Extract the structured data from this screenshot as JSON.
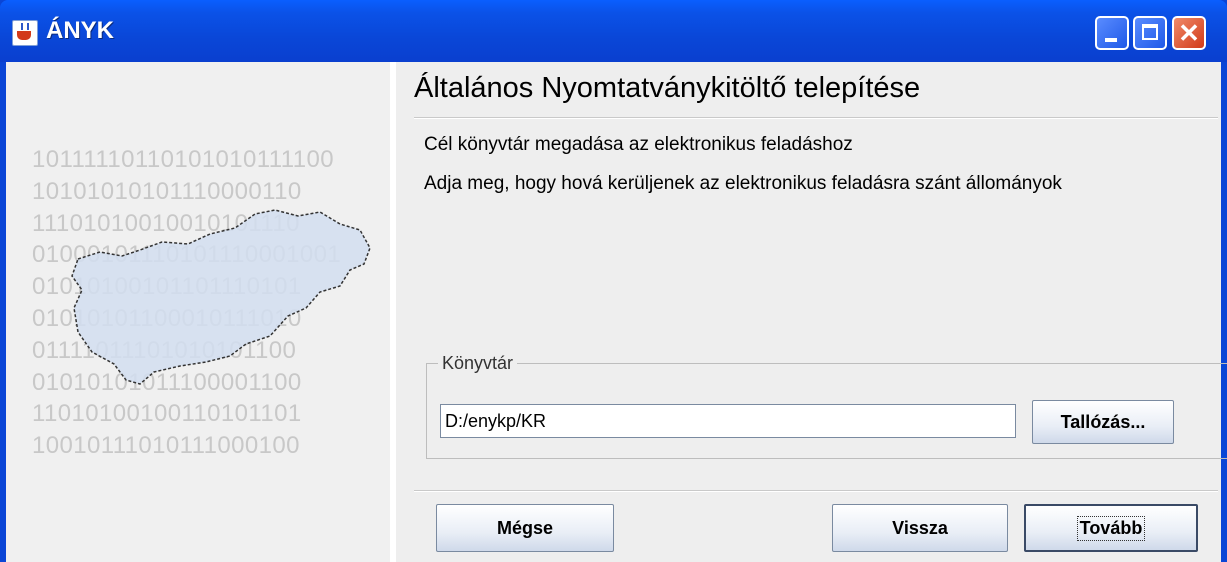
{
  "window": {
    "title": "ÁNYK"
  },
  "left_panel": {
    "binary_rows": [
      "10111110110101010111100",
      "10101010101110000110",
      "11101010010010101110",
      "01000101110101110001001",
      "01010100101101110101",
      "01010101100010111010",
      "01111011101010101100",
      "01010101011100001100",
      "11010100100110101101",
      "10010111010111000100"
    ]
  },
  "main": {
    "heading": "Általános Nyomtatványkitöltő telepítése",
    "subtitle": "Cél könyvtár megadása az elektronikus feladáshoz",
    "description": "Adja meg, hogy hová kerüljenek az elektronikus feladásra szánt állományok"
  },
  "directory_group": {
    "legend": "Könyvtár",
    "path_value": "D:/enykp/KR",
    "browse_label": "Tallózás..."
  },
  "buttons": {
    "cancel_label": "Mégse",
    "back_label": "Vissza",
    "next_label": "Tovább"
  }
}
